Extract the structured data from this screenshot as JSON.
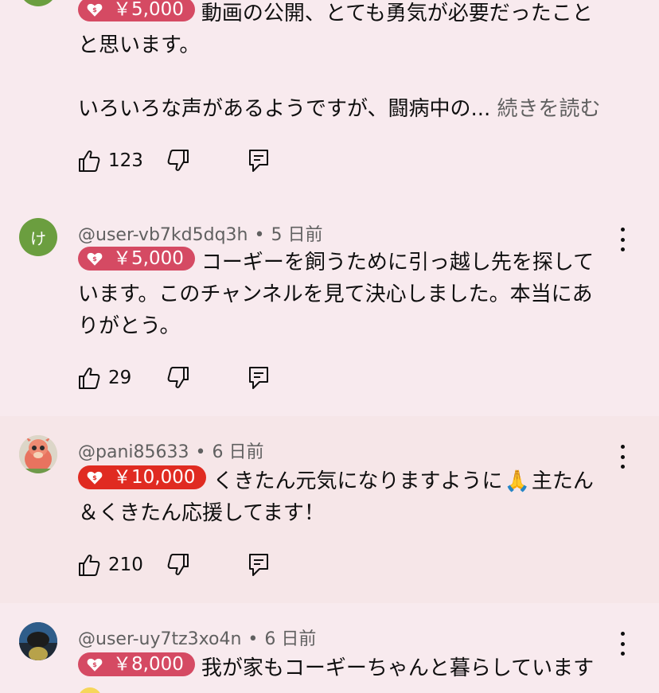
{
  "colors": {
    "page_bg": "#f8eaee",
    "highlight_bg": "#f6e6e8",
    "badge_rose": "#d54a63",
    "badge_red": "#e02b21"
  },
  "comments": [
    {
      "badge_amount": "￥5,000",
      "body_line1": "動画の公開、とても勇気が必要だったこと",
      "body_line2": "と思います。",
      "body_line3": "いろいろな声があるようですが、闘病中の...",
      "read_more": "続きを読む",
      "likes": "123",
      "icons": [
        "like-icon",
        "dislike-icon",
        "reply-icon"
      ]
    },
    {
      "avatar_letter": "け",
      "avatar_color": "#6b9e3f",
      "handle": "@user-vb7kd5dq3h",
      "time": "5 日前",
      "badge_amount": "￥5,000",
      "body_line1": "コーギーを飼うために引っ越し先を探して",
      "body_line2": "います。このチャンネルを見て決心しました。本当にあ",
      "body_line3": "りがとう。",
      "likes": "29"
    },
    {
      "handle": "@pani85633",
      "time": "6 日前",
      "badge_amount": "￥10,000",
      "body_line1": "くきたん元気になりますように",
      "emoji": "🙏",
      "body_line1b": "主たん",
      "body_line2": "＆くきたん応援してます！",
      "likes": "210"
    },
    {
      "handle": "@user-uy7tz3xo4n",
      "time": "6 日前",
      "badge_amount": "￥8,000",
      "body_line1": "我が家もコーギーちゃんと暮らしています"
    }
  ]
}
